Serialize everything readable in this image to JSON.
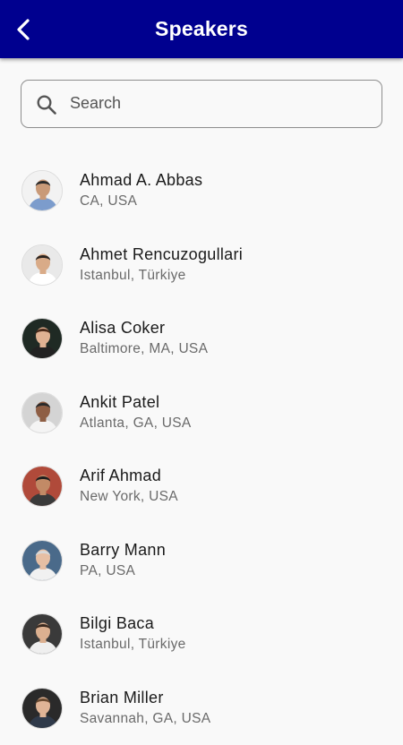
{
  "header": {
    "title": "Speakers",
    "back_icon": "chevron-left-icon",
    "background": "#00008f"
  },
  "search": {
    "placeholder": "Search",
    "value": "",
    "icon": "search-icon"
  },
  "speakers": [
    {
      "name": "Ahmad A. Abbas",
      "location": "CA, USA",
      "photo_bg": "#f2f2f2",
      "suit": "#7c9ccc",
      "skin": "#c99a78",
      "hair": "#2b2b2b"
    },
    {
      "name": "Ahmet Rencuzogullari",
      "location": "Istanbul, Türkiye",
      "photo_bg": "#e9e9e9",
      "suit": "#ffffff",
      "skin": "#d9ab88",
      "hair": "#2a2420"
    },
    {
      "name": "Alisa Coker",
      "location": "Baltimore, MA, USA",
      "photo_bg": "#1f2a24",
      "suit": "#222222",
      "skin": "#e0b293",
      "hair": "#4a2a1a"
    },
    {
      "name": "Ankit Patel",
      "location": "Atlanta, GA, USA",
      "photo_bg": "#d4d4d4",
      "suit": "#f4f4f4",
      "skin": "#8e5e44",
      "hair": "#2a2a2a"
    },
    {
      "name": "Arif Ahmad",
      "location": "New York, USA",
      "photo_bg": "#b04a3a",
      "suit": "#3a3a3a",
      "skin": "#c28a66",
      "hair": "#1e1e1e"
    },
    {
      "name": "Barry Mann",
      "location": "PA, USA",
      "photo_bg": "#4a6a8a",
      "suit": "#f1f1f1",
      "skin": "#e6bfa4",
      "hair": "#d8d8d8"
    },
    {
      "name": "Bilgi Baca",
      "location": "Istanbul, Türkiye",
      "photo_bg": "#3a3a3a",
      "suit": "#efefef",
      "skin": "#dcb090",
      "hair": "#3a2a20"
    },
    {
      "name": "Brian Miller",
      "location": "Savannah, GA, USA",
      "photo_bg": "#2a2a2a",
      "suit": "#2f3a4a",
      "skin": "#e0b496",
      "hair": "#6a4a30"
    }
  ]
}
